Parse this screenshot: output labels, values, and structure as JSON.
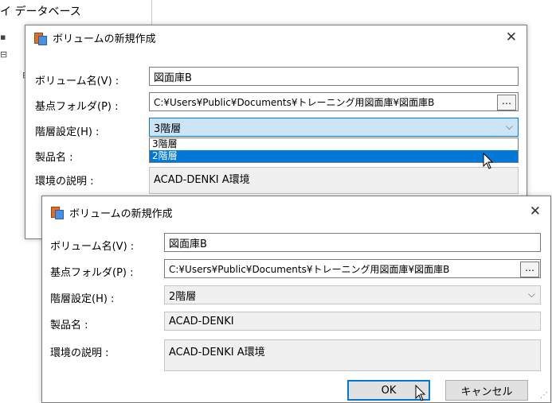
{
  "background": {
    "tree_header": "イ データベース"
  },
  "dialog_back": {
    "title": "ボリュームの新規作成",
    "close": "✕",
    "fields": {
      "volume_label": "ボリューム名(V) :",
      "volume_value": "図面庫B",
      "base_label": "基点フォルダ(P) :",
      "base_value": "C:¥Users¥Public¥Documents¥トレーニング用図面庫¥図面庫B",
      "browse": "…",
      "hier_label": "階層設定(H) :",
      "hier_value": "3階層",
      "product_label": "製品名 :",
      "env_label": "環境の説明 :",
      "env_value": "ACAD-DENKI A環境"
    },
    "dropdown_options": [
      "3階層",
      "2階層"
    ],
    "dropdown_selected_index": 1
  },
  "dialog_front": {
    "title": "ボリュームの新規作成",
    "close": "✕",
    "fields": {
      "volume_label": "ボリューム名(V) :",
      "volume_value": "図面庫B",
      "base_label": "基点フォルダ(P) :",
      "base_value": "C:¥Users¥Public¥Documents¥トレーニング用図面庫¥図面庫B",
      "browse": "…",
      "hier_label": "階層設定(H) :",
      "hier_value": "2階層",
      "product_label": "製品名 :",
      "product_value": "ACAD-DENKI",
      "env_label": "環境の説明 :",
      "env_value": "ACAD-DENKI A環境"
    },
    "buttons": {
      "ok": "OK",
      "cancel": "キャンセル"
    }
  },
  "icons": {
    "app": "volume-app-icon",
    "chevron": "chevron-down-icon",
    "cursor": "mouse-pointer-icon"
  },
  "colors": {
    "accent": "#0078d7",
    "selection_bg": "#cce4f7",
    "readonly_bg": "#f0f0f0"
  }
}
